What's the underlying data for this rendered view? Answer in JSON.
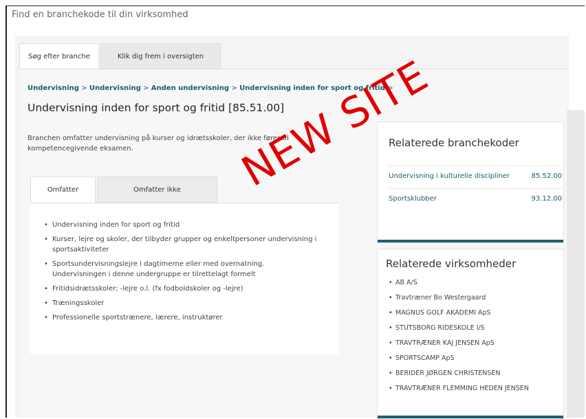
{
  "header": {
    "title": "Find en branchekode til din virksomhed"
  },
  "tabs": [
    {
      "label": "Søg efter branche"
    },
    {
      "label": "Klik dig frem i oversigten"
    }
  ],
  "breadcrumb": [
    "Undervisning",
    "Undervisning",
    "Anden undervisning",
    "Undervisning inden for sport og fritid"
  ],
  "breadcrumb_sep": ">",
  "breadcrumb_tail": ">",
  "page_title": "Undervisning inden for sport og fritid [85.51.00]",
  "description": "Branchen omfatter undervisning på kurser og idrætsskoler, der ikke fører til kompetencegivende eksamen.",
  "subtabs": [
    {
      "label": "Omfatter"
    },
    {
      "label": "Omfatter ikke"
    }
  ],
  "includes": [
    "Undervisning inden for sport og fritid",
    "Kurser, lejre og skoler, der tilbyder grupper og enkeltpersoner undervisning i sportsaktiviteter",
    "Sportsundervisningslejre i dagtimerne eller med overnatning. Undervisningen i denne undergruppe er tilrettelagt formelt",
    "Fritidsidrætsskoler; -lejre o.l. (fx fodboldskoler og -lejre)",
    "Træningsskoler",
    "Professionelle sportstrænere, lærere, instruktører"
  ],
  "related_codes": {
    "title": "Relaterede branchekoder",
    "items": [
      {
        "label": "Undervisning i kulturelle discipliner",
        "code": "85.52.00"
      },
      {
        "label": "Sportsklubber",
        "code": "93.12.00"
      }
    ]
  },
  "related_companies": {
    "title": "Relaterede virksomheder",
    "items": [
      "AB A/S",
      "Travtræner Bo Westergaard",
      "MAGNUS GOLF AKADEMI ApS",
      "STUTSBORG RIDESKOLE I/S",
      "TRAVTRÆNER KAJ JENSEN ApS",
      "SPORTSCAMP ApS",
      "BERIDER JØRGEN CHRISTENSEN",
      "TRAVTRÆNER FLEMMING HEDEN JENSEN"
    ]
  },
  "watermark": "NEW SITE",
  "colors": {
    "accent": "#1c5b6e",
    "bar": "#1f5e73",
    "watermark": "#e00000"
  }
}
